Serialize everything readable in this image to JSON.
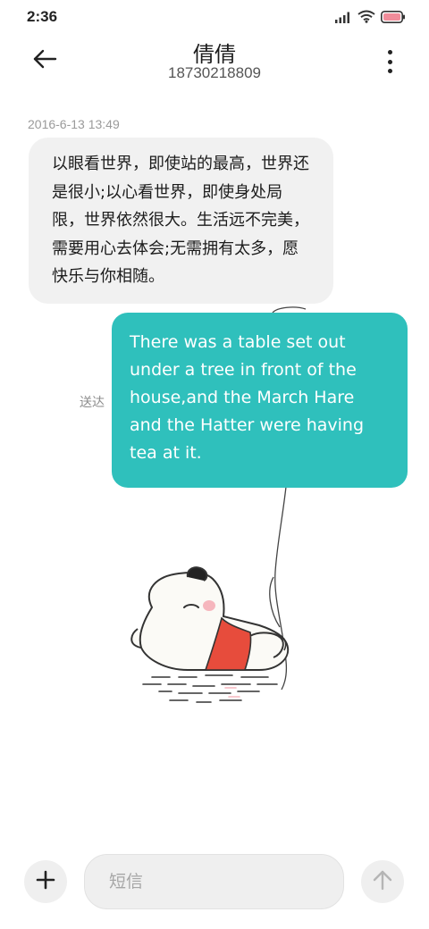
{
  "status_bar": {
    "time": "2:36",
    "icons": [
      "signal-icon",
      "wifi-icon",
      "battery-icon"
    ]
  },
  "header": {
    "contact_name": "倩倩",
    "contact_number": "18730218809",
    "icons": [
      "back-arrow-icon",
      "more-vertical-icon"
    ]
  },
  "conversation": {
    "timestamp": "2016-6-13 13:49",
    "incoming_message": "以眼看世界，即使站的最高，世界还是很小;以心看世界，即使身处局限，世界依然很大。生活远不完美，需要用心去体会;无需拥有太多，愿快乐与你相随。",
    "outgoing_message": "There was a table set out under a tree in front of the house,and the March Hare and the Hatter were having tea at it.",
    "delivery_status": "送达"
  },
  "composer": {
    "placeholder": "短信",
    "value": "",
    "icons": [
      "plus-icon",
      "send-arrow-icon"
    ]
  },
  "colors": {
    "accent": "#2fc0bc",
    "incoming_bubble": "#f1f1f1",
    "battery": "#f08c9a"
  }
}
